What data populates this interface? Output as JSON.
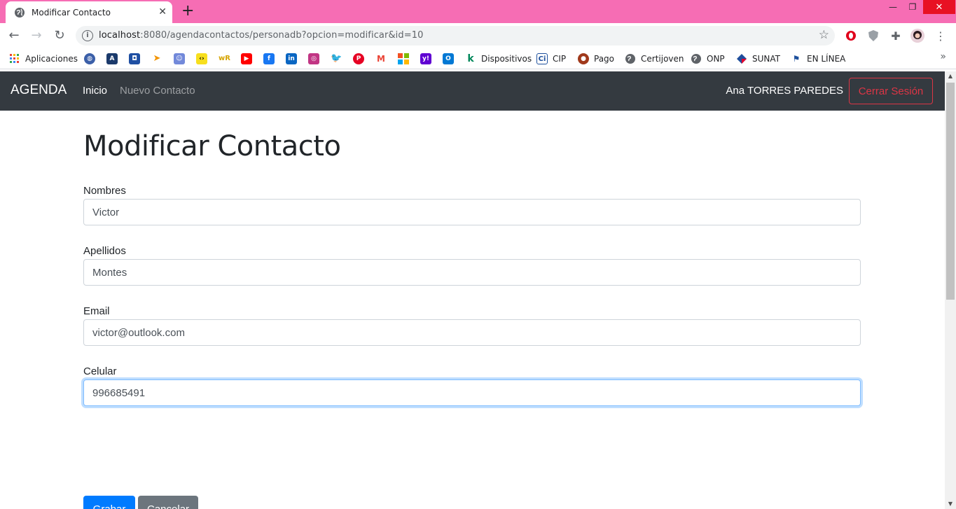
{
  "browser": {
    "tab_title": "Modificar Contacto",
    "url_host": "localhost",
    "url_rest": ":8080/agendacontactos/personadb?opcion=modificar&id=10",
    "bookmarks": [
      {
        "label": "Aplicaciones",
        "icon": "apps-grid-icon"
      },
      {
        "label": "Dispositivos",
        "icon": "k-icon"
      },
      {
        "label": "CIP",
        "icon": "cip-icon"
      },
      {
        "label": "Pago",
        "icon": "pago-icon"
      },
      {
        "label": "Certijoven",
        "icon": "globe-icon"
      },
      {
        "label": "ONP",
        "icon": "globe-icon"
      },
      {
        "label": "SUNAT",
        "icon": "sunat-icon"
      },
      {
        "label": "EN LÍNEA",
        "icon": "en-linea-icon"
      }
    ]
  },
  "navbar": {
    "brand": "AGENDA",
    "links": [
      "Inicio",
      "Nuevo Contacto"
    ],
    "user": "Ana TORRES PAREDES",
    "logout": "Cerrar Sesión"
  },
  "form": {
    "title": "Modificar Contacto",
    "fields": [
      {
        "label": "Nombres",
        "value": "Victor"
      },
      {
        "label": "Apellidos",
        "value": "Montes"
      },
      {
        "label": "Email",
        "value": "victor@outlook.com"
      },
      {
        "label": "Celular",
        "value": "996685491"
      }
    ],
    "save": "Grabar",
    "cancel": "Cancelar"
  },
  "colors": {
    "tabbar": "#f66db4",
    "navbar": "#343a40",
    "primary": "#007bff",
    "secondary": "#6c757d",
    "danger": "#dc3545"
  }
}
